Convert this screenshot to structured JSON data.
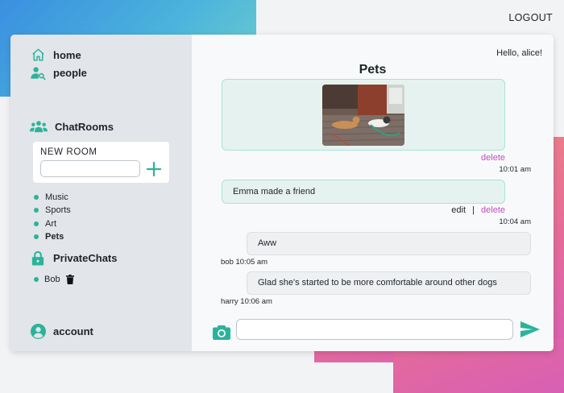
{
  "topbar": {
    "logout_label": "LOGOUT"
  },
  "sidebar": {
    "nav": {
      "home_label": "home",
      "people_label": "people",
      "chatrooms_label": "ChatRooms",
      "privatechats_label": "PrivateChats",
      "account_label": "account"
    },
    "new_room": {
      "label": "NEW ROOM",
      "input_value": "",
      "input_placeholder": ""
    },
    "rooms": [
      {
        "name": "Music",
        "active": false
      },
      {
        "name": "Sports",
        "active": false
      },
      {
        "name": "Art",
        "active": false
      },
      {
        "name": "Pets",
        "active": true
      }
    ],
    "private_chats": [
      {
        "name": "Bob"
      }
    ]
  },
  "main": {
    "greeting": "Hello, alice!",
    "room_title": "Pets",
    "messages": [
      {
        "type": "image",
        "owner": "self",
        "actions": {
          "delete_label": "delete"
        },
        "time": "10:01 am"
      },
      {
        "type": "text",
        "owner": "self",
        "text": "Emma made a friend",
        "actions": {
          "edit_label": "edit",
          "separator": "|",
          "delete_label": "delete"
        },
        "time": "10:04 am"
      },
      {
        "type": "text",
        "owner": "other",
        "text": "Aww",
        "meta": "bob 10:05 am"
      },
      {
        "type": "text",
        "owner": "other",
        "text": "Glad she's started to be more comfortable around other dogs",
        "meta": "harry 10:06 am"
      }
    ],
    "composer": {
      "value": "",
      "placeholder": ""
    }
  },
  "colors": {
    "accent": "#2bb39a",
    "delete": "#c04fc0",
    "sidebar_bg": "#e2e5e9",
    "bubble_mine": "#e6f2ef",
    "bubble_mine_border": "#a9e4d6"
  },
  "icons": {
    "home": "home-icon",
    "people": "people-search-icon",
    "chatrooms": "group-icon",
    "privatechats": "lock-icon",
    "account": "account-icon",
    "add": "plus-icon",
    "trash": "trash-icon",
    "camera": "camera-icon",
    "send": "send-icon"
  }
}
